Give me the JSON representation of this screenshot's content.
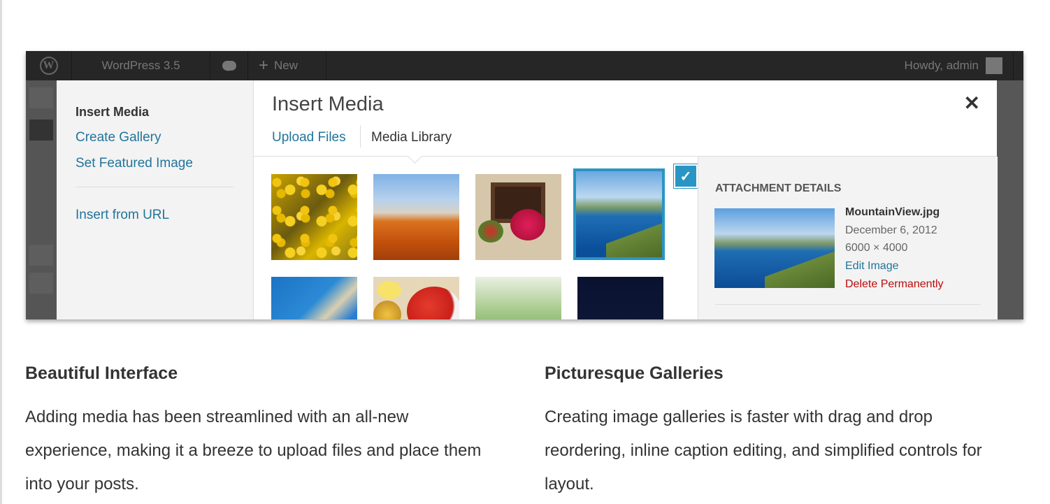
{
  "admin_bar": {
    "site_name": "WordPress 3.5",
    "new_label": "New",
    "howdy": "Howdy, admin"
  },
  "modal": {
    "menu": {
      "heading": "Insert Media",
      "create_gallery": "Create Gallery",
      "set_featured_image": "Set Featured Image",
      "insert_from_url": "Insert from URL"
    },
    "title": "Insert Media",
    "close_glyph": "✕",
    "tabs": [
      "Upload Files",
      "Media Library"
    ],
    "selected_check_glyph": "✓",
    "attachment": {
      "heading": "ATTACHMENT DETAILS",
      "filename": "MountainView.jpg",
      "date": "December 6, 2012",
      "dimensions": "6000 × 4000",
      "edit_link": "Edit Image",
      "delete_link": "Delete Permanently"
    }
  },
  "features": [
    {
      "title": "Beautiful Interface",
      "body": "Adding media has been streamlined with an all-new experience, making it a breeze to upload files and place them into your posts."
    },
    {
      "title": "Picturesque Galleries",
      "body": "Creating image galleries is faster with drag and drop reordering, inline caption editing, and simplified controls for layout."
    }
  ],
  "colors": {
    "link": "#21759b",
    "delete": "#bc0b0b",
    "selected_border": "#2a95c5",
    "admin_bar_bg": "#262626"
  }
}
